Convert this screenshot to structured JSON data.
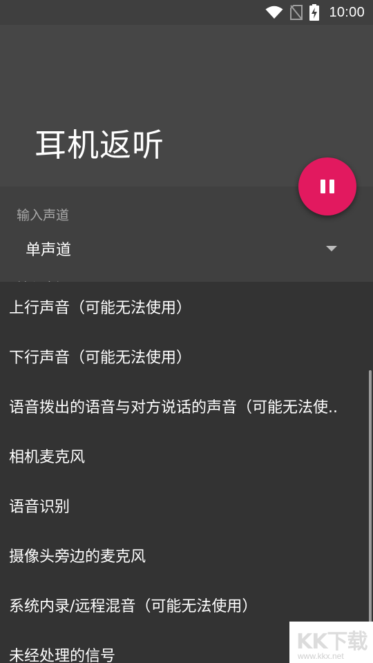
{
  "status_bar": {
    "time": "10:00",
    "icons": [
      "wifi-icon",
      "no-sim-icon",
      "battery-charging-icon"
    ]
  },
  "app_bar": {
    "title": "耳机返听"
  },
  "settings": {
    "channel_label": "输入声道",
    "channel_value": "单声道",
    "source_label": "输入来源"
  },
  "fab": {
    "icon": "pause-icon",
    "color": "#e2195f"
  },
  "source_options": [
    {
      "label": "上行声音（可能无法使用）"
    },
    {
      "label": "下行声音（可能无法使用）"
    },
    {
      "label": "语音拨出的语音与对方说话的声音（可能无法使.."
    },
    {
      "label": "相机麦克风"
    },
    {
      "label": "语音识别"
    },
    {
      "label": "摄像头旁边的麦克风"
    },
    {
      "label": "系统内录/远程混音（可能无法使用）"
    },
    {
      "label": "未经处理的信号"
    }
  ],
  "watermark": {
    "logo_text": "KK下载",
    "url": "www.kkx.net"
  }
}
